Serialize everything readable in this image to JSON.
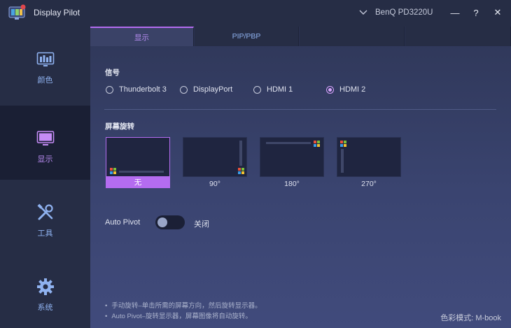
{
  "app": {
    "title": "Display Pilot",
    "monitor": "BenQ PD3220U"
  },
  "window": {
    "minimize": "—",
    "help": "?",
    "close": "✕"
  },
  "sidebar": {
    "items": [
      {
        "label": "颜色",
        "icon": "palette-monitor-icon"
      },
      {
        "label": "显示",
        "icon": "monitor-icon",
        "active": true
      },
      {
        "label": "工具",
        "icon": "tools-icon"
      },
      {
        "label": "系统",
        "icon": "gear-icon"
      }
    ]
  },
  "tabs": [
    {
      "label": "显示",
      "active": true
    },
    {
      "label": "PIP/PBP"
    },
    {
      "label": ""
    },
    {
      "label": ""
    }
  ],
  "signal": {
    "title": "信号",
    "options": [
      {
        "label": "Thunderbolt 3",
        "checked": false
      },
      {
        "label": "DisplayPort",
        "checked": false
      },
      {
        "label": "HDMI 1",
        "checked": false
      },
      {
        "label": "HDMI 2",
        "checked": true
      }
    ]
  },
  "rotation": {
    "title": "屏幕旋转",
    "options": [
      {
        "label": "无",
        "selected": true
      },
      {
        "label": "90°"
      },
      {
        "label": "180°"
      },
      {
        "label": "270°"
      }
    ]
  },
  "auto_pivot": {
    "label": "Auto Pivot",
    "state": "关闭",
    "on": false
  },
  "notes": [
    "手动旋转–单击所需的屏幕方向，然后旋转显示器。",
    "Auto Pivot–旋转显示器，屏幕图像将自动旋转。"
  ],
  "color_mode": "色彩模式: M-book",
  "colors": {
    "accent": "#b46cf0",
    "link": "#8fb2f0",
    "bg": "#232a42"
  }
}
